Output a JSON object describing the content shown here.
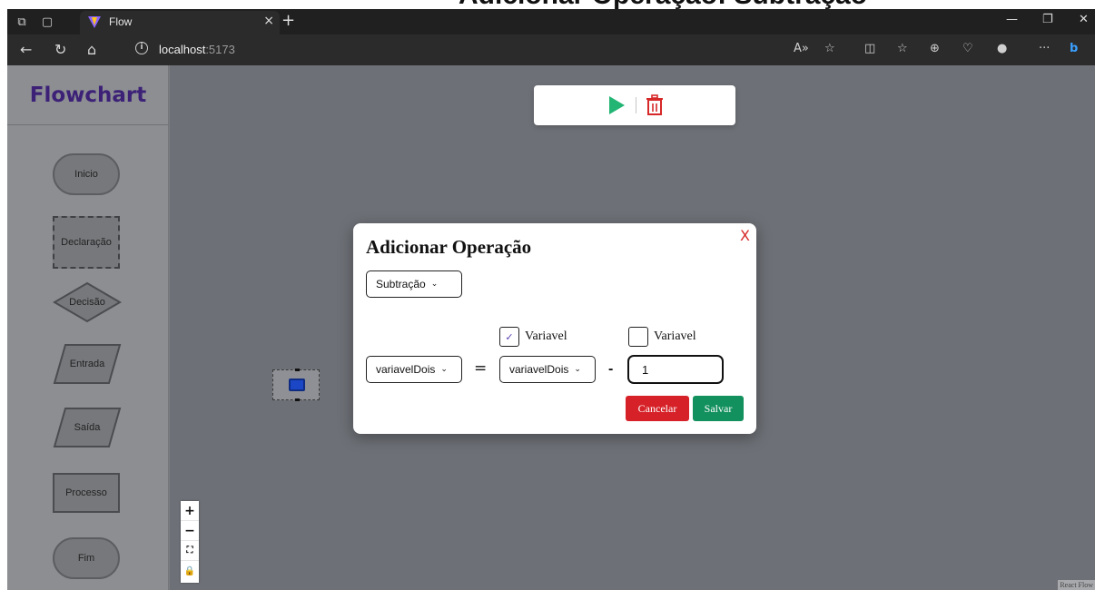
{
  "caption": {
    "text": "Adicionar Operação: Subtração"
  },
  "browser": {
    "tab_title": "Flow",
    "url_host": "localhost",
    "url_port": ":5173"
  },
  "sidebar": {
    "brand": "Flowchart",
    "nodes": [
      {
        "label": "Inicio",
        "shape": "terminator"
      },
      {
        "label": "Declaração",
        "shape": "dashed-rectangle"
      },
      {
        "label": "Decisão",
        "shape": "diamond"
      },
      {
        "label": "Entrada",
        "shape": "parallelogram"
      },
      {
        "label": "Saída",
        "shape": "parallelogram"
      },
      {
        "label": "Processo",
        "shape": "rectangle"
      },
      {
        "label": "Fim",
        "shape": "terminator"
      }
    ]
  },
  "toolbar": {
    "play_icon": "play-icon",
    "delete_icon": "trash-icon",
    "play_color": "#22b573",
    "delete_color": "#d62828"
  },
  "controls": {
    "zoom_in": "+",
    "zoom_out": "−",
    "fit": "⛶",
    "lock": "🔒"
  },
  "attribution": "React Flow",
  "modal": {
    "title": "Adicionar Operação",
    "close": "X",
    "operation": {
      "selected": "Subtração"
    },
    "left_variable": {
      "selected": "variavelDois"
    },
    "equals": "=",
    "right_variable": {
      "selected": "variavelDois",
      "checkbox_label": "Variavel",
      "checked": true
    },
    "operator": "-",
    "operand": {
      "value": "1",
      "checkbox_label": "Variavel",
      "checked": false
    },
    "cancel_label": "Cancelar",
    "save_label": "Salvar",
    "cancel_color": "#d62128",
    "save_color": "#12905d"
  }
}
